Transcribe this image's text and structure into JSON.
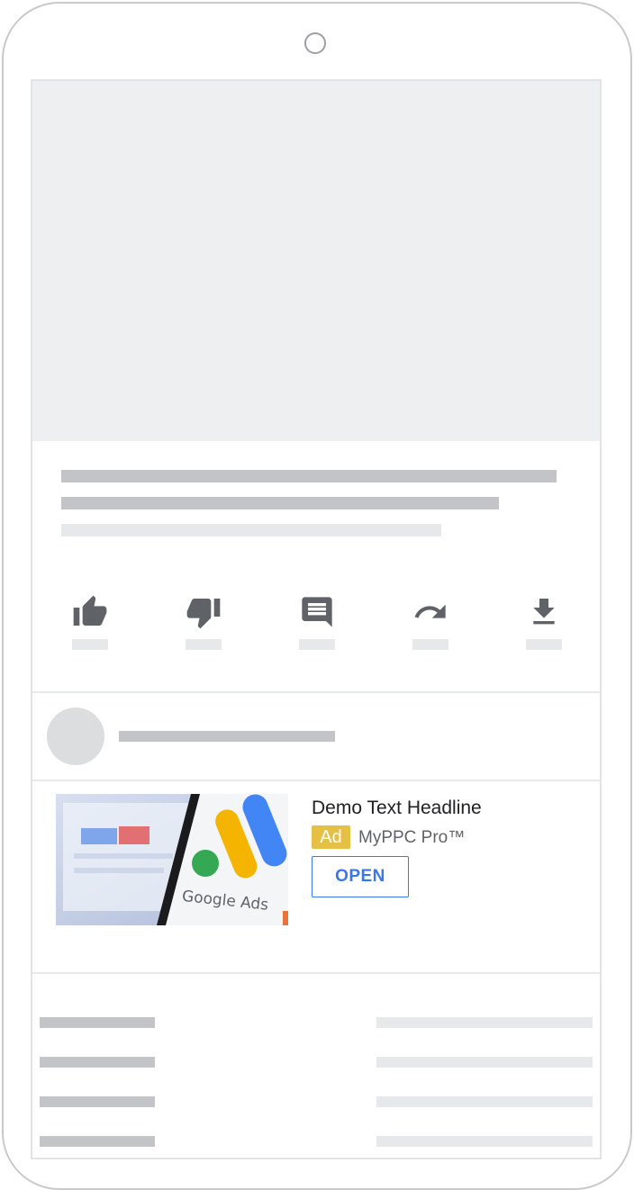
{
  "ad": {
    "headline": "Demo Text Headline",
    "badge": "Ad",
    "advertiser": "MyPPC Pro™",
    "cta": "OPEN",
    "image_caption": "Google Ads"
  },
  "actions": [
    {
      "icon": "thumb-up-icon"
    },
    {
      "icon": "thumb-down-icon"
    },
    {
      "icon": "comment-icon"
    },
    {
      "icon": "share-icon"
    },
    {
      "icon": "download-icon"
    }
  ],
  "colors": {
    "icon": "#5f6368",
    "skeleton_dark": "#c3c4c7",
    "skeleton_light": "#e7e8ea",
    "video_placeholder": "#eeeff1",
    "ad_badge": "#e6c044",
    "cta": "#3b78e7"
  }
}
